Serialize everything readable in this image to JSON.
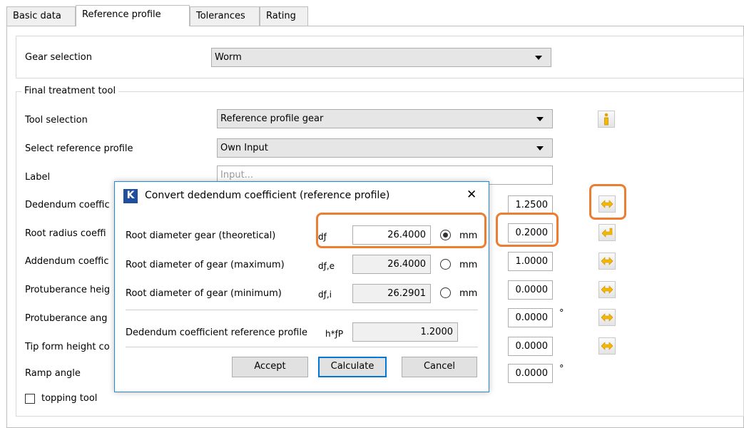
{
  "tabs": [
    "Basic data",
    "Reference profile",
    "Tolerances",
    "Rating"
  ],
  "gear_selection": {
    "label": "Gear selection",
    "value": "Worm"
  },
  "final_tool": {
    "group_title": "Final treatment tool",
    "tool_selection": {
      "label": "Tool selection",
      "value": "Reference profile gear"
    },
    "select_reference_profile": {
      "label": "Select reference profile",
      "value": "Own Input"
    },
    "label_field": {
      "label": "Label",
      "placeholder": "Input..."
    },
    "rows": [
      {
        "label": "Dedendum coeffic",
        "value": "1.2500"
      },
      {
        "label": "Root radius coeffi",
        "value": "0.2000"
      },
      {
        "label": "Addendum coeffic",
        "value": "1.0000"
      },
      {
        "label": "Protuberance heig",
        "value": "0.0000"
      },
      {
        "label": "Protuberance ang",
        "value": "0.0000",
        "unit": "°"
      },
      {
        "label": "Tip form height co",
        "value": "0.0000"
      },
      {
        "label": "Ramp angle",
        "value": "0.0000",
        "unit": "°"
      }
    ],
    "topping_tool": {
      "label": "topping tool",
      "checked": false
    }
  },
  "dialog": {
    "logo": "K",
    "title": "Convert dedendum coefficient (reference profile)",
    "close_glyph": "✕",
    "rows": [
      {
        "label": "Root diameter gear (theoretical)",
        "symbol": "dƒ",
        "value": "26.4000",
        "unit": "mm",
        "selected": true
      },
      {
        "label": "Root diameter of gear (maximum)",
        "symbol": "dƒ,e",
        "value": "26.4000",
        "unit": "mm",
        "selected": false
      },
      {
        "label": "Root diameter of gear (minimum)",
        "symbol": "dƒ,i",
        "value": "26.2901",
        "unit": "mm",
        "selected": false
      }
    ],
    "dedendum_ref": {
      "label": "Dedendum coefficient reference profile",
      "symbol": "h*ƒP",
      "value": "1.2000"
    },
    "buttons": {
      "accept": "Accept",
      "calculate": "Calculate",
      "cancel": "Cancel"
    }
  },
  "icons": {
    "info": "info-icon",
    "convert": "double-arrow-icon",
    "return": "return-arrow-icon"
  },
  "colors": {
    "highlight": "#ed7d31",
    "icon": "#f5b800",
    "dialog_border": "#1e88e5"
  }
}
